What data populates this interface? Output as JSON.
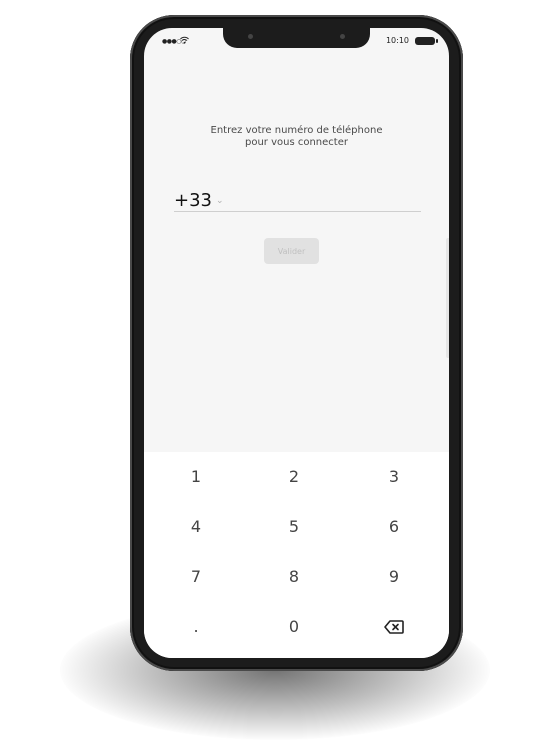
{
  "status_bar": {
    "signal": "●●●○○",
    "wifi_icon": "wifi-icon",
    "time": "10:10",
    "battery_icon": "battery-icon"
  },
  "login": {
    "prompt_line1": "Entrez votre numéro de téléphone",
    "prompt_line2": "pour vous connecter",
    "country_code": "+33",
    "country_chevron": "⌄",
    "phone_number_value": "",
    "validate_label": "Valider"
  },
  "keypad": {
    "keys": [
      "1",
      "2",
      "3",
      "4",
      "5",
      "6",
      "7",
      "8",
      "9",
      ".",
      "0"
    ],
    "backspace_icon": "backspace-icon"
  },
  "colors": {
    "screen_bg": "#f6f6f6",
    "keypad_bg": "#ffffff",
    "phone_frame": "#1c1c1c",
    "button_disabled_bg": "#e1e1e1",
    "button_disabled_text": "#c0c0c0"
  }
}
